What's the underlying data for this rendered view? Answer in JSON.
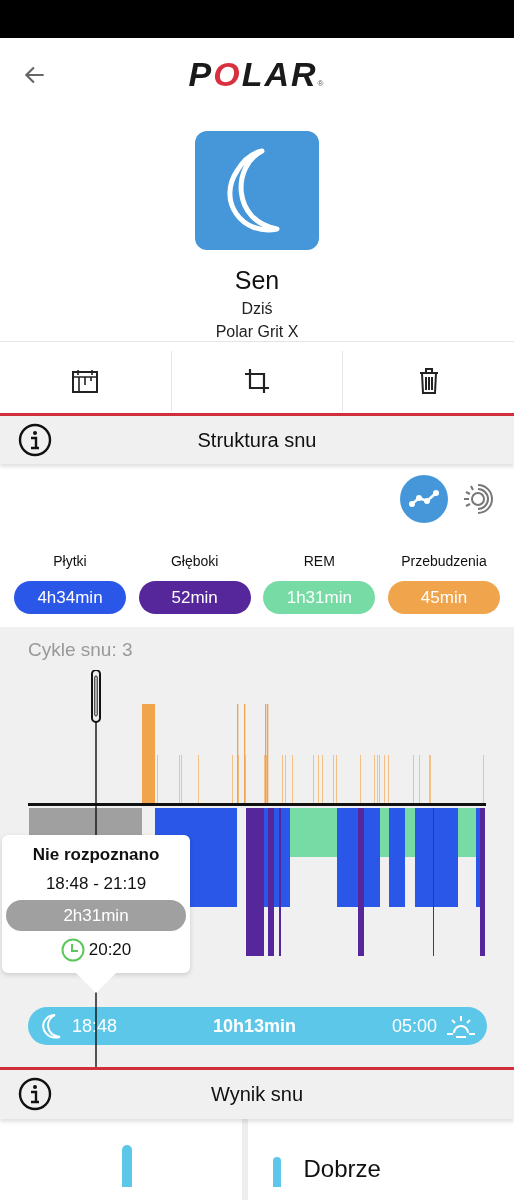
{
  "header": {
    "logo": "POLAR",
    "logo_mark": "®"
  },
  "activity": {
    "title": "Sen",
    "date": "Dziś",
    "device": "Polar Grit X"
  },
  "structure_section": {
    "title": "Struktura snu"
  },
  "view_toggles": [
    {
      "kind": "graph",
      "selected": true
    },
    {
      "kind": "sun",
      "selected": false
    }
  ],
  "stages": [
    {
      "label": "Płytki",
      "value": "4h34min",
      "color": "#2b57e8"
    },
    {
      "label": "Głęboki",
      "value": "52min",
      "color": "#55279a"
    },
    {
      "label": "REM",
      "value": "1h31min",
      "color": "#77dba5"
    },
    {
      "label": "Przebudzenia",
      "value": "45min",
      "color": "#f0a44c"
    }
  ],
  "chart": {
    "cycles_label": "Cykle snu: 3",
    "tooltip": {
      "title": "Nie rozpoznano",
      "time_range": "18:48 - 21:19",
      "duration": "2h31min",
      "time": "20:20"
    },
    "timeline": {
      "start": "18:48",
      "duration": "10h13min",
      "end": "05:00"
    }
  },
  "score_section": {
    "title": "Wynik snu",
    "rating": "Dobrze"
  }
}
